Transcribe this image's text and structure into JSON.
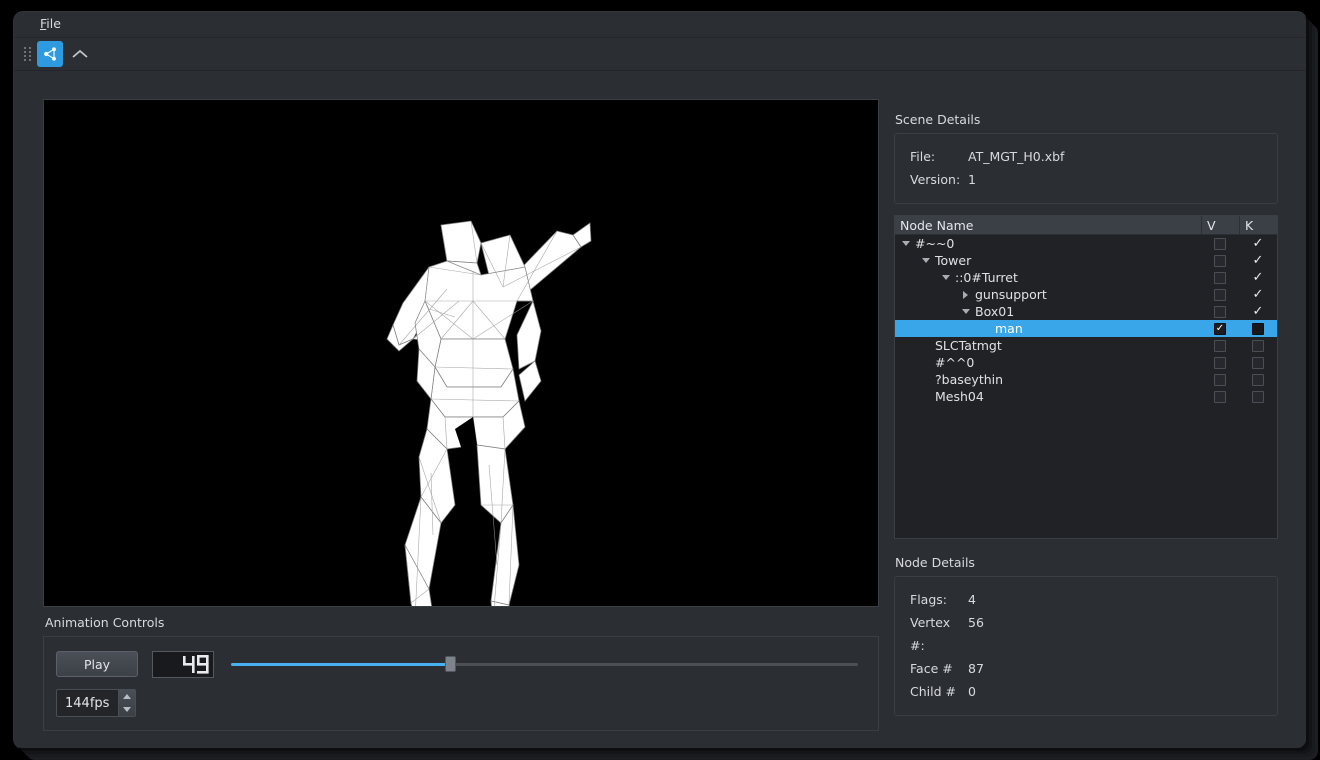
{
  "window": {
    "menu": [
      {
        "label": "File",
        "accel_index": 1
      }
    ],
    "toolbar": {
      "grip_name": "toolbar-grip",
      "buttons": [
        {
          "name": "scene-graph-icon",
          "label": "",
          "active": true
        },
        {
          "name": "chevron-up-icon",
          "label": "",
          "active": false
        }
      ]
    }
  },
  "viewport": {
    "name": "3d-viewport",
    "background": "#000000",
    "model_name": "man",
    "mesh_fill": "#ffffff",
    "mesh_edge": "#7a7a7a"
  },
  "animation": {
    "section_label": "Animation Controls",
    "play_label": "Play",
    "frame_display": "49",
    "slider": {
      "value_percent": 35,
      "min": 0,
      "max": 100
    },
    "fps_value": "144fps"
  },
  "scene_details": {
    "section_label": "Scene Details",
    "rows": [
      {
        "key": "File:",
        "value": "AT_MGT_H0.xbf"
      },
      {
        "key": "Version:",
        "value": "1"
      }
    ]
  },
  "tree": {
    "columns": [
      "Node Name",
      "V",
      "K"
    ],
    "rows": [
      {
        "label": "#~~0",
        "indent": 0,
        "arrow": "down",
        "v": "empty",
        "k": "check",
        "selected": false
      },
      {
        "label": "Tower",
        "indent": 1,
        "arrow": "down",
        "v": "empty",
        "k": "check",
        "selected": false
      },
      {
        "label": "::0#Turret",
        "indent": 2,
        "arrow": "down",
        "v": "empty",
        "k": "check",
        "selected": false
      },
      {
        "label": "gunsupport",
        "indent": 3,
        "arrow": "right",
        "v": "empty",
        "k": "check",
        "selected": false
      },
      {
        "label": "Box01",
        "indent": 3,
        "arrow": "down",
        "v": "empty",
        "k": "check",
        "selected": false
      },
      {
        "label": "man",
        "indent": 4,
        "arrow": "none",
        "v": "checked",
        "k": "filled",
        "selected": true
      },
      {
        "label": "SLCTatmgt",
        "indent": 1,
        "arrow": "none",
        "v": "empty",
        "k": "empty",
        "selected": false
      },
      {
        "label": "#^^0",
        "indent": 1,
        "arrow": "none",
        "v": "empty",
        "k": "empty",
        "selected": false
      },
      {
        "label": "?baseythin",
        "indent": 1,
        "arrow": "none",
        "v": "empty",
        "k": "empty",
        "selected": false
      },
      {
        "label": "Mesh04",
        "indent": 1,
        "arrow": "none",
        "v": "empty",
        "k": "empty",
        "selected": false
      }
    ]
  },
  "node_details": {
    "section_label": "Node Details",
    "rows": [
      {
        "key": "Flags:",
        "value": "4"
      },
      {
        "key": "Vertex #:",
        "value": "56"
      },
      {
        "key": "Face #",
        "value": "87"
      },
      {
        "key": "Child #",
        "value": "0"
      }
    ]
  },
  "colors": {
    "accent": "#38a6e8",
    "toolbar_active": "#2e9be0",
    "slider_fill": "#49b0ef",
    "panel_bg": "#2b2e33",
    "tree_bg": "#202226",
    "text": "#d8dade"
  }
}
